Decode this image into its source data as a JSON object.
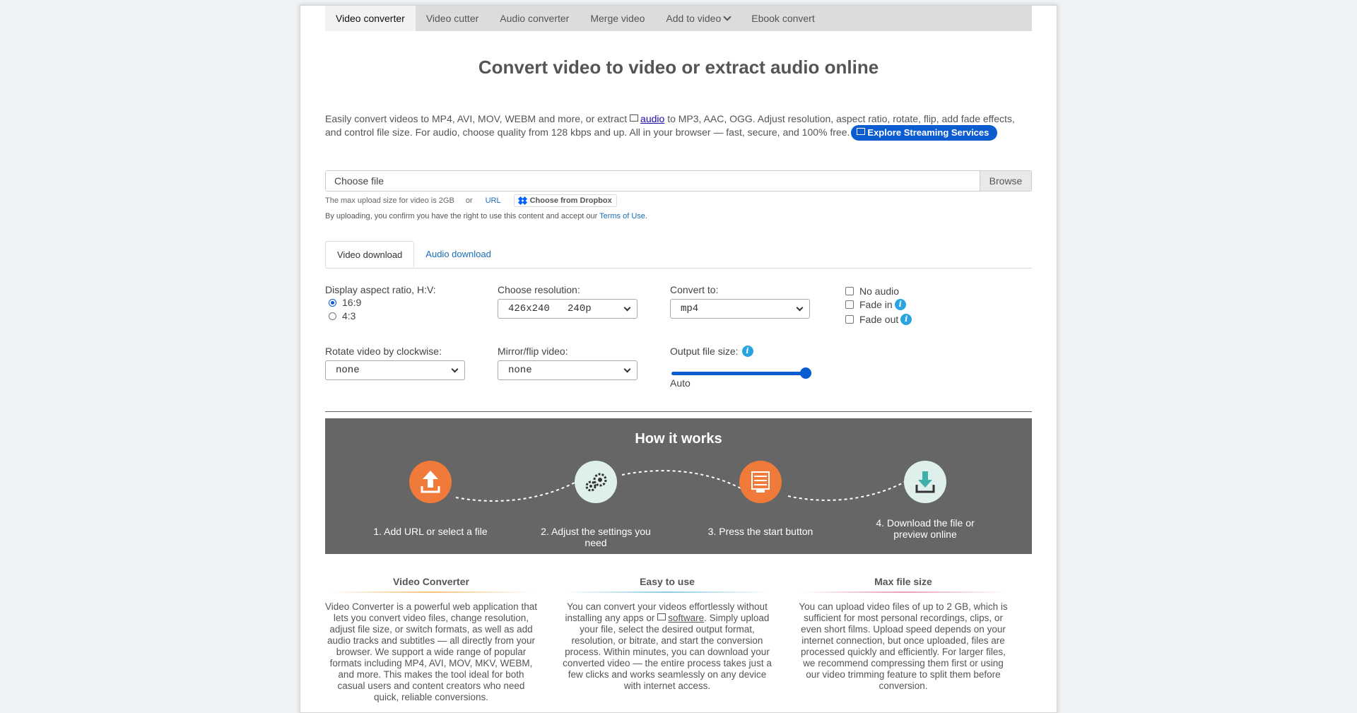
{
  "nav": {
    "items": [
      "Video converter",
      "Video cutter",
      "Audio converter",
      "Merge video",
      "Add to video",
      "Ebook convert"
    ]
  },
  "page_title": "Convert video to video or extract audio online",
  "intro": {
    "text1": "Easily convert videos to MP4, AVI, MOV, WEBM and more, or extract ",
    "link": "audio",
    "text2": " to MP3, AAC, OGG. Adjust resolution, aspect ratio, rotate, flip, add fade effects, and control file size. For audio, choose quality from 128 kbps and up. All in your browser — fast, secure, and 100% free.",
    "pill": "Explore Streaming Services"
  },
  "upload": {
    "placeholder": "Choose file",
    "browse": "Browse",
    "max_size": "The max upload size for video is 2GB",
    "or": "or",
    "url": "URL",
    "dropbox": "Choose from Dropbox",
    "terms_text": "By uploading, you confirm you have the right to use this content and accept our ",
    "terms_link": "Terms of Use",
    "terms_end": "."
  },
  "tabs": [
    "Video download",
    "Audio download"
  ],
  "settings": {
    "aspect_label": "Display aspect ratio, H:V:",
    "aspect_options": [
      "16:9",
      "4:3"
    ],
    "aspect_selected": "16:9",
    "resolution_label": "Choose resolution:",
    "resolution_value": "426x240   240p",
    "convert_label": "Convert to:",
    "convert_value": "mp4",
    "no_audio": "No audio",
    "fade_in": "Fade in",
    "fade_out": "Fade out",
    "rotate_label": "Rotate video by clockwise:",
    "rotate_value": "none",
    "mirror_label": "Mirror/flip video:",
    "mirror_value": "none",
    "output_label": "Output file size:",
    "output_value": "Auto",
    "output_slider_fraction": 1.0
  },
  "how": {
    "title": "How it works",
    "steps": [
      "1. Add URL or select a file",
      "2. Adjust the settings you need",
      "3. Press the start button",
      "4. Download the file or preview online"
    ],
    "icons": [
      "upload-icon",
      "gears-icon",
      "server-icon",
      "download-icon"
    ]
  },
  "features": [
    {
      "title": "Video Converter",
      "text": "Video Converter is a powerful web application that lets you convert video files, change resolution, adjust file size, or switch formats, as well as add audio tracks and subtitles — all directly from your browser. We support a wide range of popular formats including MP4, AVI, MOV, MKV, WEBM, and more. This makes the tool ideal for both casual users and content creators who need quick, reliable conversions."
    },
    {
      "title": "Easy to use",
      "text1": "You can convert your videos effortlessly without installing any apps or ",
      "link": "software",
      "text2": ". Simply upload your file, select the desired output format, resolution, or bitrate, and start the conversion process. Within minutes, you can download your converted video — the entire process takes just a few clicks and works seamlessly on any device with internet access."
    },
    {
      "title": "Max file size",
      "text": "You can upload video files of up to 2 GB, which is sufficient for most personal recordings, clips, or even short films. Upload speed depends on your internet connection, but once uploaded, files are processed quickly and efficiently. For larger files, we recommend compressing them first or using our video trimming feature to split them before conversion."
    }
  ],
  "colors": {
    "accent": "#0b5bd1",
    "orange": "#f07a3a",
    "info": "#2aa4e0"
  }
}
